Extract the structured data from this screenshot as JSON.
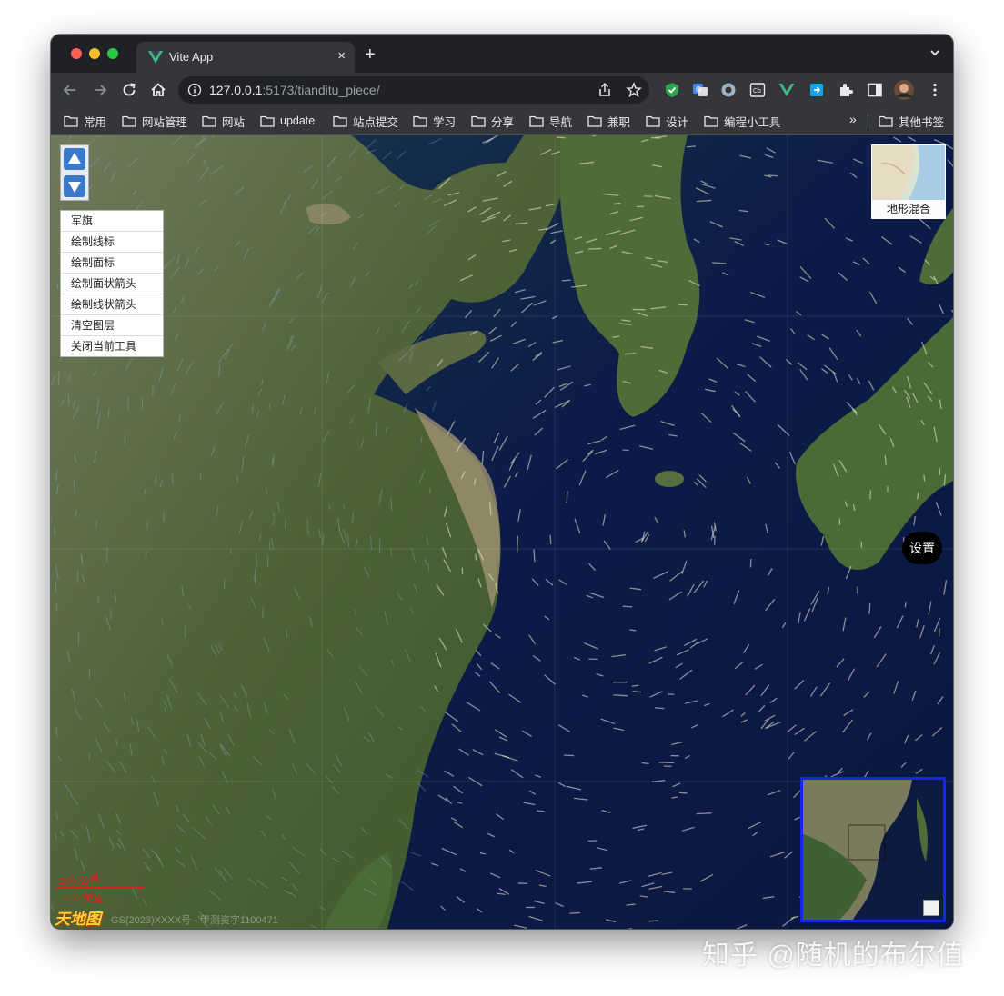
{
  "browser": {
    "tab_title": "Vite App",
    "tab_close": "×",
    "new_tab": "+",
    "url_host": "127.0.0.1",
    "url_rest": ":5173/tianditu_piece/",
    "bookmarks": [
      "常用",
      "网站管理",
      "网站",
      "update",
      "站点提交",
      "学习",
      "分享",
      "导航",
      "兼职",
      "设计",
      "编程小工具"
    ],
    "bookmarks_more": "»",
    "other_bookmarks": "其他书签",
    "colors": {
      "chrome_bg": "#202124",
      "toolbar_bg": "#35363a",
      "vue_green": "#41b883"
    }
  },
  "map": {
    "tools_menu": [
      "军旗",
      "绘制线标",
      "绘制面标",
      "绘制面状箭头",
      "绘制线状箭头",
      "清空图层",
      "关闭当前工具"
    ],
    "layer_switch_label": "地形混合",
    "settings_label": "设置",
    "scale_top": "200 公里",
    "scale_bottom": "100 英里",
    "logo_text": "天地图",
    "copyright": "GS(2023)XXXX号 - 甲测资字1100471",
    "colors": {
      "overview_border": "#1428e0",
      "scale_color": "#e02020"
    }
  },
  "watermark": "知乎 @随机的布尔值"
}
